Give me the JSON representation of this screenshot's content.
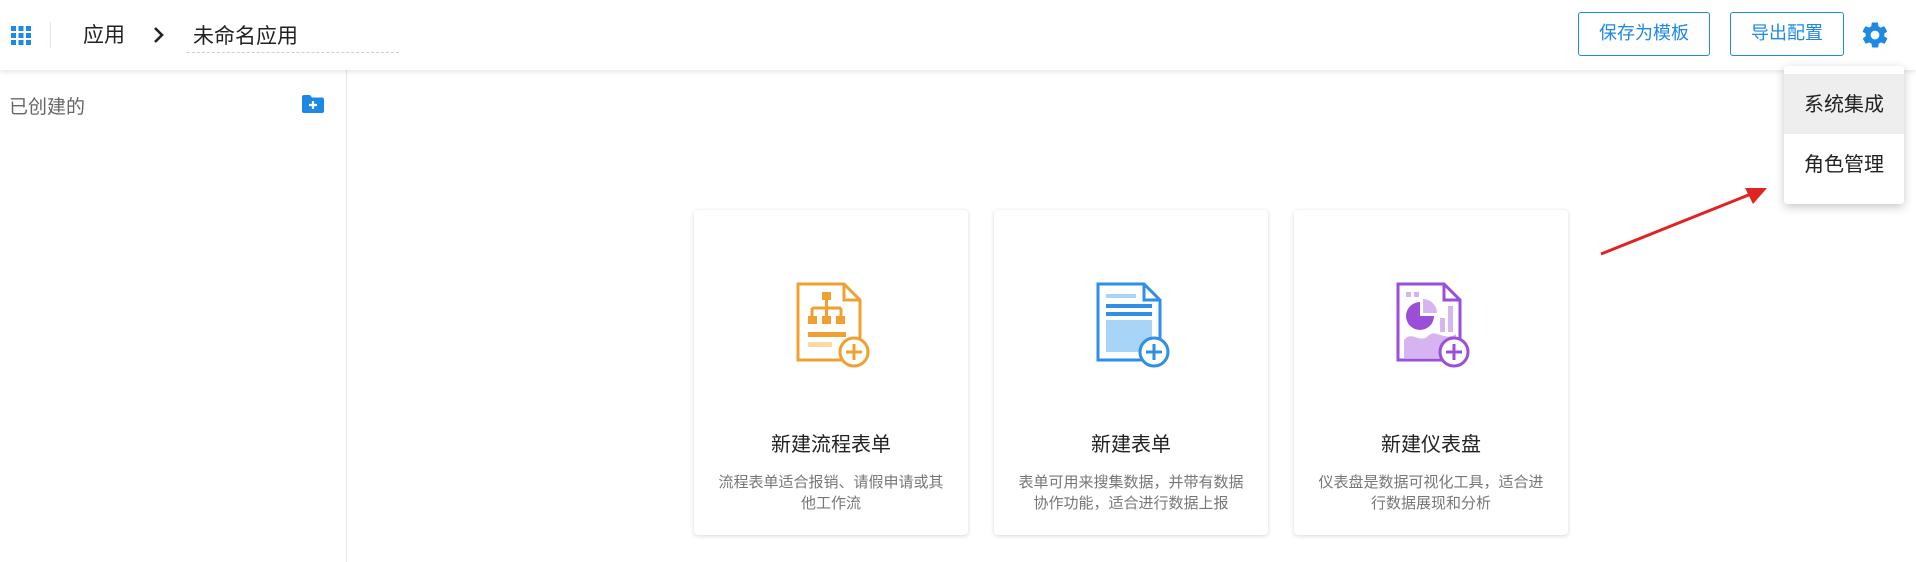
{
  "header": {
    "apps_icon": "grid-apps-icon",
    "breadcrumb_root": "应用",
    "chevron_icon": "chevron-right-icon",
    "app_name_value": "未命名应用",
    "save_template_label": "保存为模板",
    "export_config_label": "导出配置",
    "settings_icon": "gear-icon"
  },
  "sidebar": {
    "title": "已创建的",
    "new_folder_icon": "folder-plus-icon"
  },
  "cards": [
    {
      "title": "新建流程表单",
      "desc": "流程表单适合报销、请假申请或其他工作流",
      "icon": "workflow-form-icon",
      "color": "#f0a030"
    },
    {
      "title": "新建表单",
      "desc": "表单可用来搜集数据，并带有数据协作功能，适合进行数据上报",
      "icon": "form-document-icon",
      "color": "#2f8ee6"
    },
    {
      "title": "新建仪表盘",
      "desc": "仪表盘是数据可视化工具，适合进行数据展现和分析",
      "icon": "dashboard-chart-icon",
      "color": "#9b4fd8"
    }
  ],
  "menu": {
    "items": [
      {
        "label": "系统集成",
        "active": true
      },
      {
        "label": "角色管理",
        "active": false
      }
    ]
  },
  "colors": {
    "accent": "#1e88e5",
    "annotation_arrow": "#e02424"
  }
}
